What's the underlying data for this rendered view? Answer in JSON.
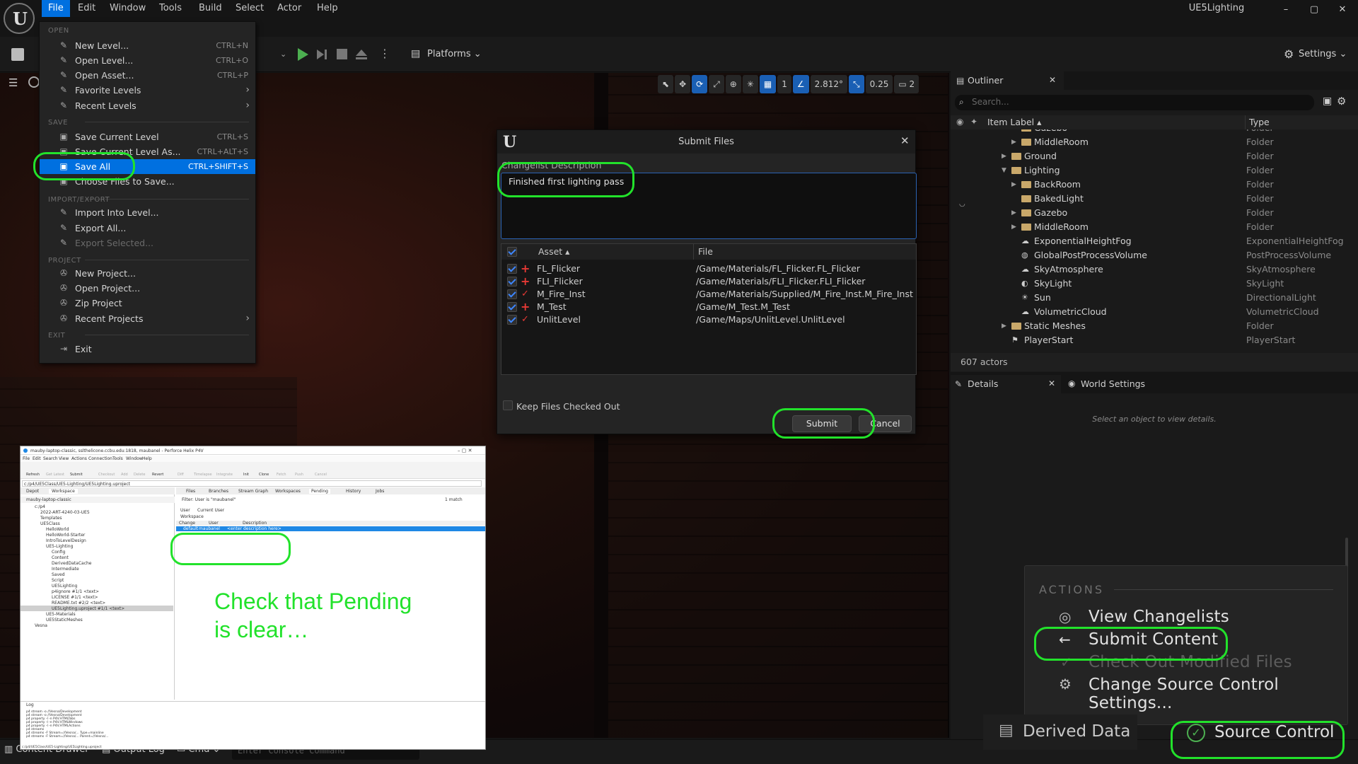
{
  "app": {
    "title": "UE5Lighting",
    "logo_letter": "U",
    "window_controls": [
      "–",
      "▢",
      "✕"
    ]
  },
  "menubar": [
    "File",
    "Edit",
    "Window",
    "Tools",
    "Build",
    "Select",
    "Actor",
    "Help"
  ],
  "toolbar": {
    "platforms_label": "Platforms",
    "settings_label": "Settings"
  },
  "viewport_toolbar": {
    "grid_value": "1",
    "angle_value": "2.812°",
    "scale_value": "0.25",
    "camera_speed": "2"
  },
  "file_menu": {
    "sections": {
      "open": "OPEN",
      "save": "SAVE",
      "import_export": "IMPORT/EXPORT",
      "project": "PROJECT",
      "exit": "EXIT"
    },
    "items": [
      {
        "label": "New Level...",
        "shortcut": "CTRL+N"
      },
      {
        "label": "Open Level...",
        "shortcut": "CTRL+O"
      },
      {
        "label": "Open Asset...",
        "shortcut": "CTRL+P"
      },
      {
        "label": "Favorite Levels",
        "shortcut": ""
      },
      {
        "label": "Recent Levels",
        "shortcut": ""
      },
      {
        "label": "Save Current Level",
        "shortcut": "CTRL+S"
      },
      {
        "label": "Save Current Level As...",
        "shortcut": "CTRL+ALT+S"
      },
      {
        "label": "Save All",
        "shortcut": "CTRL+SHIFT+S"
      },
      {
        "label": "Choose Files to Save...",
        "shortcut": ""
      },
      {
        "label": "Import Into Level...",
        "shortcut": ""
      },
      {
        "label": "Export All...",
        "shortcut": ""
      },
      {
        "label": "Export Selected...",
        "shortcut": ""
      },
      {
        "label": "New Project...",
        "shortcut": ""
      },
      {
        "label": "Open Project...",
        "shortcut": ""
      },
      {
        "label": "Zip Project",
        "shortcut": ""
      },
      {
        "label": "Recent Projects",
        "shortcut": ""
      },
      {
        "label": "Exit",
        "shortcut": ""
      }
    ]
  },
  "submit_dialog": {
    "title": "Submit Files",
    "changelist_label": "Changelist Description",
    "description": "Finished first lighting pass",
    "col_asset": "Asset",
    "col_file": "File",
    "rows": [
      {
        "asset": "FL_Flicker",
        "file": "/Game/Materials/FL_Flicker.FL_Flicker",
        "status": "add"
      },
      {
        "asset": "FLI_Flicker",
        "file": "/Game/Materials/FLI_Flicker.FLI_Flicker",
        "status": "add"
      },
      {
        "asset": "M_Fire_Inst",
        "file": "/Game/Materials/Supplied/M_Fire_Inst.M_Fire_Inst",
        "status": "edit"
      },
      {
        "asset": "M_Test",
        "file": "/Game/M_Test.M_Test",
        "status": "add"
      },
      {
        "asset": "UnlitLevel",
        "file": "/Game/Maps/UnlitLevel.UnlitLevel",
        "status": "edit"
      }
    ],
    "keep_checked_out": "Keep Files Checked Out",
    "submit_label": "Submit",
    "cancel_label": "Cancel"
  },
  "outliner": {
    "tab_label": "Outliner",
    "search_placeholder": "Search...",
    "col_label": "Item Label",
    "col_type": "Type",
    "rows": [
      {
        "name": "Gazebo",
        "type": "Folder"
      },
      {
        "name": "MiddleRoom",
        "type": "Folder"
      },
      {
        "name": "Ground",
        "type": "Folder"
      },
      {
        "name": "Lighting",
        "type": "Folder"
      },
      {
        "name": "BackRoom",
        "type": "Folder"
      },
      {
        "name": "BakedLight",
        "type": "Folder"
      },
      {
        "name": "Gazebo",
        "type": "Folder"
      },
      {
        "name": "MiddleRoom",
        "type": "Folder"
      },
      {
        "name": "ExponentialHeightFog",
        "type": "ExponentialHeightFog"
      },
      {
        "name": "GlobalPostProcessVolume",
        "type": "PostProcessVolume"
      },
      {
        "name": "SkyAtmosphere",
        "type": "SkyAtmosphere"
      },
      {
        "name": "SkyLight",
        "type": "SkyLight"
      },
      {
        "name": "Sun",
        "type": "DirectionalLight"
      },
      {
        "name": "VolumetricCloud",
        "type": "VolumetricCloud"
      },
      {
        "name": "Static Meshes",
        "type": "Folder"
      },
      {
        "name": "PlayerStart",
        "type": "PlayerStart"
      }
    ],
    "actor_count": "607 actors"
  },
  "details": {
    "tab_label": "Details",
    "world_settings_label": "World Settings",
    "empty_text": "Select an object to view details."
  },
  "actions_popup": {
    "header": "ACTIONS",
    "items": [
      "View Changelists",
      "Submit Content",
      "Check Out Modified Files",
      "Change Source Control Settings..."
    ]
  },
  "bottombar": {
    "content_drawer": "Content Drawer",
    "output_log": "Output Log",
    "cmd": "Cmd",
    "console_placeholder": "Enter Console Command",
    "derived_data": "Derived Data",
    "source_control": "Source Control"
  },
  "p4v": {
    "title": "mauby-laptop-classic, sslthelicone.ccbu.edu:1818, maubanel - Perforce Helix P4V",
    "menus": [
      "File",
      "Edit",
      "Search",
      "View",
      "Actions",
      "Connection",
      "Tools",
      "Window",
      "Help"
    ],
    "toolbar": [
      "Refresh",
      "Get Latest",
      "Submit",
      "Checkout",
      "Add",
      "Delete",
      "Revert",
      "Diff",
      "Timelapse",
      "Integrate",
      "Init",
      "Clone",
      "Fetch",
      "Push",
      "Cancel"
    ],
    "path": "c:/p4/UE5Class/UE5-Lighting/UE5Lighting.uproject",
    "left_tabs": [
      "Depot",
      "Workspace"
    ],
    "workspace_root": "mauby-laptop-classic",
    "tree": [
      "c:/p4",
      "2022-ART-4240-03-UE5",
      "Templates",
      "UE5Class",
      "HelloWorld",
      "HelloWorld-Starter",
      "IntroToLevelDesign",
      "UE5-Lighting",
      "Config",
      "Content",
      "DerivedDataCache",
      "Intermediate",
      "Saved",
      "Script",
      "UE5Lighting",
      "p4ignore #1/1 <text>",
      "LICENSE #1/1 <text>",
      "README.txt #2/2 <text>",
      "UE5Lighting.uproject #1/1 <text>",
      "UE5-Materials",
      "UE5StaticMeshes",
      "Vesna"
    ],
    "right_tabs": [
      "Files",
      "Branches",
      "Stream Graph",
      "Workspaces",
      "Pending",
      "History",
      "Jobs"
    ],
    "filter": "Filter: User is \"maubanel\"",
    "user_label": "User",
    "user_value": "Current User",
    "workspace_label": "Workspace",
    "match_count": "1 match",
    "cols": [
      "Change",
      "User",
      "Description"
    ],
    "pending_row": {
      "change": "default",
      "user": "maubanel",
      "description": "<enter description here>"
    },
    "log_tab": "Log",
    "log_lines": [
      "p4 stream -o //Vesna/Development",
      "p4 stream -o //Vesna/Development",
      "p4 property -l -n P4V.HTMLTabs",
      "p4 property -l -n P4V.HTMLWindows",
      "p4 property -l -n P4V.HTMLActions",
      "p4 streams",
      "p4 streams -F Stream=//Vesna/... Type=mainline",
      "p4 streams -F Stream=//Vesna/... Parent=//Vesna/..."
    ],
    "status_path": "c:/p4/UE5Class/UE5-Lighting/UE5Lighting.uproject"
  },
  "annotation": {
    "line1": "Check that Pending",
    "line2": "is clear…"
  },
  "colors": {
    "highlight_green": "#22e22b",
    "menu_blue": "#0070e0",
    "ue_bg": "#1a1a1a"
  }
}
